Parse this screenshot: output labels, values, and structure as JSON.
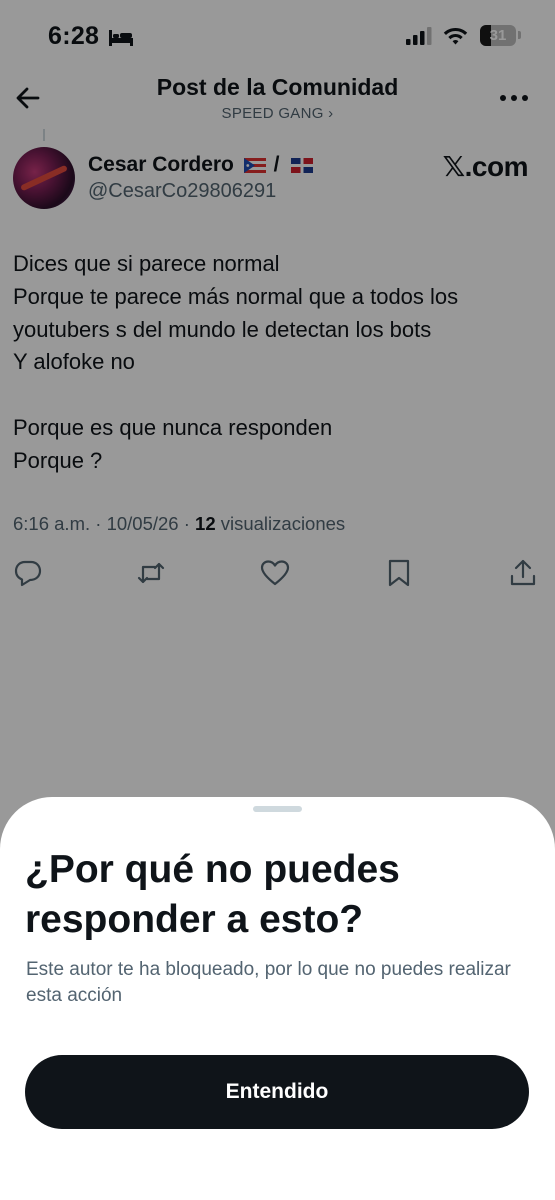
{
  "status_bar": {
    "time": "6:28",
    "battery_percent": "31",
    "battery_level": 0.31,
    "icons": [
      "bed-icon",
      "signal-icon",
      "wifi-icon",
      "battery-icon"
    ]
  },
  "header": {
    "title": "Post de la Comunidad",
    "subtitle": "SPEED GANG ›",
    "back_icon": "arrow-left-icon",
    "more_icon": "more-horizontal-icon"
  },
  "post": {
    "author_name": "Cesar Cordero",
    "name_separator": "/",
    "flags": [
      "puerto-rico-flag",
      "dominican-republic-flag"
    ],
    "handle": "@CesarCo29806291",
    "source_label": "𝕏.com",
    "body_lines": [
      "Dices que si parece normal",
      "Porque te parece más normal que a todos los",
      "youtubers s del mundo le detectan los bots",
      "Y alofoke no",
      "",
      "Porque es que nunca responden",
      "Porque ?"
    ],
    "timestamp": "6:16 a.m. · 10/05/26 · ",
    "views_count": "12",
    "views_label": " visualizaciones",
    "actions": [
      "reply-icon",
      "repost-icon",
      "like-icon",
      "bookmark-icon",
      "share-icon"
    ]
  },
  "sheet": {
    "title": "¿Por qué no puedes responder a esto?",
    "description": "Este autor te ha bloqueado, por lo que no puedes realizar esta acción",
    "button_label": "Entendido"
  },
  "colors": {
    "text_primary": "#0f1419",
    "text_secondary": "#536471",
    "overlay": "rgba(0,0,0,0.4)",
    "button_bg": "#0f1419"
  }
}
